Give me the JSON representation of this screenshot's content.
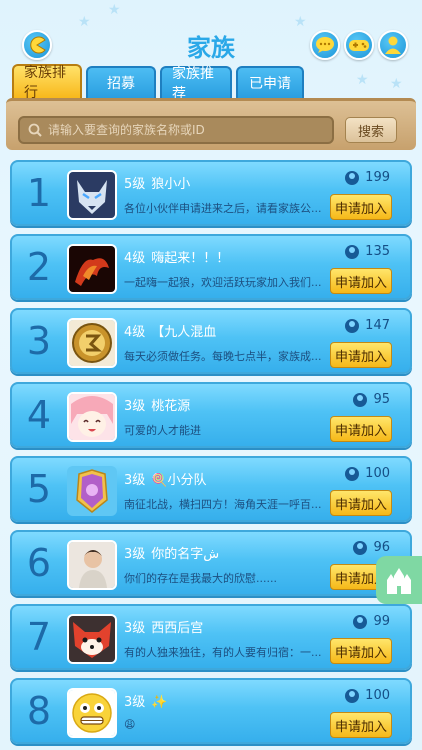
{
  "header": {
    "title": "家族",
    "back_icon": "pacman-back-icon",
    "chat_icon": "chat-bubble-icon",
    "game_icon": "gamepad-icon",
    "profile_icon": "person-icon"
  },
  "tabs": [
    {
      "label": "家族排行",
      "active": true
    },
    {
      "label": "招募",
      "active": false
    },
    {
      "label": "家族推荐",
      "active": false
    },
    {
      "label": "已申请",
      "active": false
    }
  ],
  "search": {
    "placeholder": "请输入要查询的家族名称或ID",
    "button_label": "搜索"
  },
  "families": [
    {
      "rank": "1",
      "level": "5级",
      "name": "狼小小",
      "members": "199",
      "desc": "各位小伙伴申请进来之后，请看家族公...",
      "join": "申请加入",
      "avatar": "wolf-avatar"
    },
    {
      "rank": "2",
      "level": "4级",
      "name": "嗨起来！！！",
      "members": "135",
      "desc": "一起嗨一起狼，欢迎活跃玩家加入我们...",
      "join": "申请加入",
      "avatar": "fire-dragon-avatar"
    },
    {
      "rank": "3",
      "level": "4级",
      "name": "【九人混血",
      "members": "147",
      "desc": "每天必须做任务。每晚七点半，家族成...",
      "join": "申请加入",
      "avatar": "gold-emblem-avatar"
    },
    {
      "rank": "4",
      "level": "3级",
      "name": "桃花源",
      "members": "95",
      "desc": "可爱的人才能进",
      "join": "申请加入",
      "avatar": "anime-girl-avatar"
    },
    {
      "rank": "5",
      "level": "3级",
      "name": "🍭小分队",
      "members": "100",
      "desc": "南征北战，横扫四方！海角天涯一呼百...",
      "join": "申请加入",
      "avatar": "purple-crest-avatar"
    },
    {
      "rank": "6",
      "level": "3级",
      "name": "你的名字ش",
      "members": "96",
      "desc": "你们的存在是我最大的欣慰......",
      "join": "申请加入",
      "avatar": "child-photo-avatar"
    },
    {
      "rank": "7",
      "level": "3级",
      "name": "西西后宫",
      "members": "99",
      "desc": "有的人独来独往，有的人要有归宿：一...",
      "join": "申请加入",
      "avatar": "red-fox-avatar"
    },
    {
      "rank": "8",
      "level": "3级",
      "name": "✨",
      "members": "100",
      "desc": "😩",
      "join": "申请加入",
      "avatar": "emoji-face-avatar"
    }
  ],
  "castle_button_icon": "castle-icon"
}
